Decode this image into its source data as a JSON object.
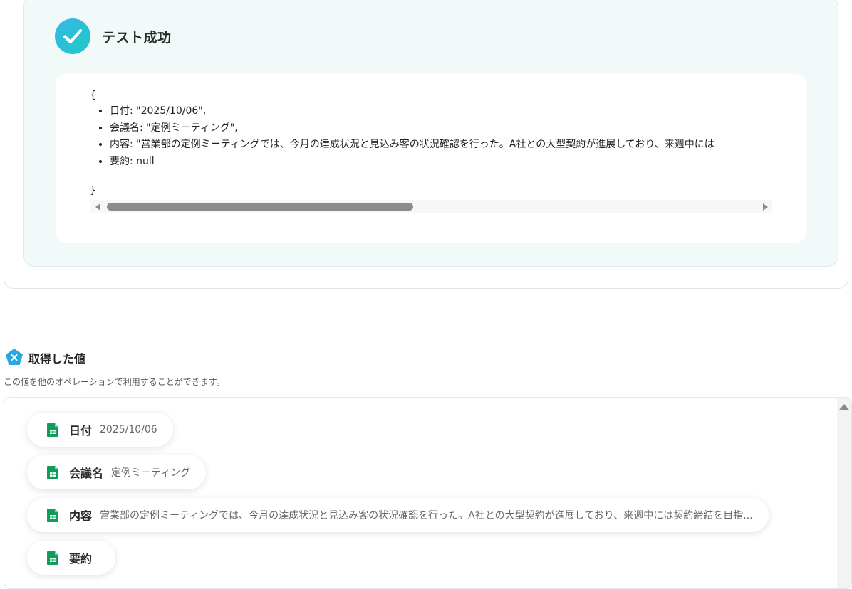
{
  "test_result": {
    "title": "テスト成功",
    "json_open": "{",
    "json_close": "}",
    "items": [
      "日付: \"2025/10/06\",",
      "会議名: \"定例ミーティング\",",
      "内容: \"営業部の定例ミーティングでは、今月の達成状況と見込み客の状況確認を行った。A社との大型契約が進展しており、来週中には",
      "要約: null"
    ]
  },
  "retrieved_values": {
    "title": "取得した値",
    "description": "この値を他のオペレーションで利用することができます。",
    "items": [
      {
        "key": "日付",
        "value": "2025/10/06",
        "icon": "google-sheets-icon"
      },
      {
        "key": "会議名",
        "value": "定例ミーティング",
        "icon": "google-sheets-icon"
      },
      {
        "key": "内容",
        "value": "営業部の定例ミーティングでは、今月の達成状況と見込み客の状況確認を行った。A社との大型契約が進展しており、来週中には契約締結を目指...",
        "icon": "google-sheets-icon"
      },
      {
        "key": "要約",
        "value": "",
        "icon": "google-sheets-icon"
      }
    ]
  },
  "colors": {
    "accent": "#1fc9c4",
    "panel_background": "#f1f9f9",
    "sheets_green": "#0f9d58"
  }
}
